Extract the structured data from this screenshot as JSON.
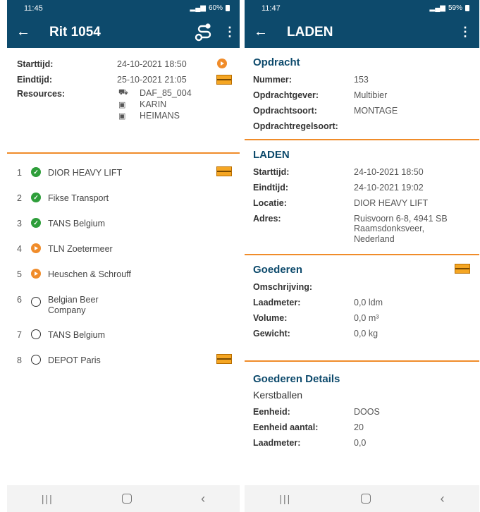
{
  "left": {
    "status": {
      "time": "11:45",
      "battery": "60%"
    },
    "appbar": {
      "back": "←",
      "title": "Rit 1054",
      "menu": "⋮"
    },
    "header": {
      "start_label": "Starttijd:",
      "start_value": "24-10-2021 18:50",
      "end_label": "Eindtijd:",
      "end_value": "25-10-2021 21:05",
      "resources_label": "Resources:",
      "resources": [
        {
          "icon": "truck-icon",
          "glyph": "⛟",
          "value": "DAF_85_004"
        },
        {
          "icon": "id-card-icon",
          "glyph": "▣",
          "value": "KARIN"
        },
        {
          "icon": "id-card-icon",
          "glyph": "▣",
          "value": "HEIMANS"
        }
      ]
    },
    "stops": [
      {
        "num": "1",
        "status": "done",
        "name": "DIOR HEAVY LIFT"
      },
      {
        "num": "2",
        "status": "done",
        "name": "Fikse Transport"
      },
      {
        "num": "3",
        "status": "done",
        "name": "TANS Belgium"
      },
      {
        "num": "4",
        "status": "active",
        "name": "TLN Zoetermeer"
      },
      {
        "num": "5",
        "status": "active",
        "name": "Heuschen & Schrouff"
      },
      {
        "num": "6",
        "status": "open",
        "name": "Belgian Beer Company"
      },
      {
        "num": "7",
        "status": "open",
        "name": "TANS Belgium"
      },
      {
        "num": "8",
        "status": "open",
        "name": "DEPOT Paris"
      }
    ]
  },
  "right": {
    "status": {
      "time": "11:47",
      "battery": "59%"
    },
    "appbar": {
      "back": "←",
      "title": "LADEN",
      "menu": "⋮"
    },
    "opdracht": {
      "title": "Opdracht",
      "rows": [
        {
          "label": "Nummer:",
          "value": "153"
        },
        {
          "label": "Opdrachtgever:",
          "value": "Multibier"
        },
        {
          "label": "Opdrachtsoort:",
          "value": "MONTAGE"
        },
        {
          "label": "Opdrachtregelsoort:",
          "value": ""
        }
      ]
    },
    "laden": {
      "title": "LADEN",
      "rows": [
        {
          "label": "Starttijd:",
          "value": "24-10-2021 18:50"
        },
        {
          "label": "Eindtijd:",
          "value": "24-10-2021 19:02"
        },
        {
          "label": "Locatie:",
          "value": "DIOR HEAVY LIFT"
        },
        {
          "label": "Adres:",
          "value": "Ruisvoorn 6-8, 4941 SB Raamsdonksveer, Nederland"
        }
      ]
    },
    "goederen": {
      "title": "Goederen",
      "rows": [
        {
          "label": "Omschrijving:",
          "value": ""
        },
        {
          "label": "Laadmeter:",
          "value": "0,0 ldm"
        },
        {
          "label": "Volume:",
          "value": "0,0 m³"
        },
        {
          "label": "Gewicht:",
          "value": "0,0 kg"
        }
      ]
    },
    "details": {
      "title": "Goederen Details",
      "subtitle": "Kerstballen",
      "rows": [
        {
          "label": "Eenheid:",
          "value": "DOOS"
        },
        {
          "label": "Eenheid aantal:",
          "value": "20"
        },
        {
          "label": "Laadmeter:",
          "value": "0,0"
        }
      ]
    }
  },
  "navbar": {
    "recent": "|||",
    "back": "‹"
  },
  "colors": {
    "primary": "#0d4a6c",
    "accent": "#f08c2a",
    "done": "#2e9e3a"
  }
}
